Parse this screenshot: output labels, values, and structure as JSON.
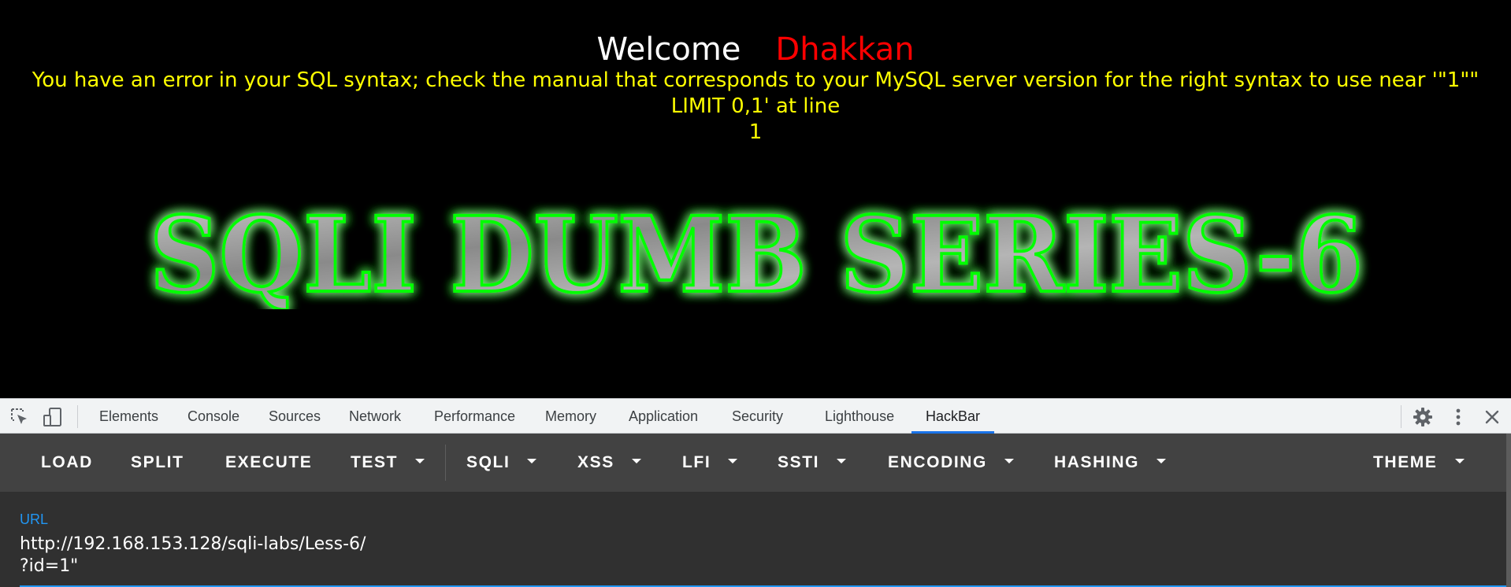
{
  "page": {
    "welcome": "Welcome",
    "user": "Dhakkan",
    "error_line1": "You have an error in your SQL syntax; check the manual that corresponds to your MySQL server version for the right syntax to use near '\"1\"\" LIMIT 0,1' at line",
    "error_line2": "1",
    "banner": "SQLI DUMB SERIES-6"
  },
  "devtools": {
    "tabs": [
      "Elements",
      "Console",
      "Sources",
      "Network",
      "Performance",
      "Memory",
      "Application",
      "Security",
      "Lighthouse",
      "HackBar"
    ],
    "active_tab": "HackBar",
    "icons": [
      "inspect-element-icon",
      "device-toolbar-icon",
      "settings-gear-icon",
      "more-options-icon",
      "close-icon"
    ]
  },
  "hackbar": {
    "buttons": [
      "LOAD",
      "SPLIT",
      "EXECUTE",
      "TEST",
      "SQLI",
      "XSS",
      "LFI",
      "SSTI",
      "ENCODING",
      "HASHING",
      "THEME"
    ],
    "url_label": "URL",
    "url_value": "http://192.168.153.128/sqli-labs/Less-6/\n?id=1\""
  },
  "colors": {
    "welcome": "#ffffff",
    "user": "#ff0000",
    "error": "#ffff00",
    "banner_glow": "#00ff00",
    "accent": "#1a73e8",
    "hackbar_bg": "#424242",
    "hackbar_panel": "#303030",
    "url_label": "#2196f3"
  }
}
